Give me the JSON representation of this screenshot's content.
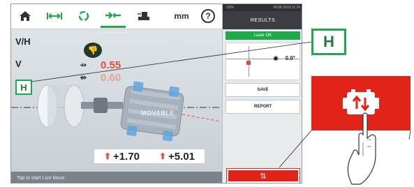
{
  "toolbar": {
    "items": [
      {
        "name": "home-icon",
        "glyph": "⌂"
      },
      {
        "name": "dimensions-icon",
        "glyph": "⟷"
      },
      {
        "name": "measure-icon",
        "glyph": "◌"
      },
      {
        "name": "results-icon",
        "glyph": "⇉"
      },
      {
        "name": "move-icon",
        "glyph": "▙"
      }
    ],
    "unit_label": "mm",
    "help_label": "?"
  },
  "side_labels": {
    "vh": "V/H",
    "v": "V",
    "h": "H"
  },
  "measurements": {
    "top_value": "0.55",
    "bottom_value": "0.60"
  },
  "machine_label": "MOVABLE",
  "bottom_values": {
    "left": "+1.70",
    "right": "+5.01"
  },
  "status_text": "Tap  to start Live Move.",
  "right_panel": {
    "status_left": "55%",
    "status_right": "09.08.2019 11:26",
    "title": "RESULTS",
    "laser_status": "Laser OK",
    "angle": "0.0°",
    "save_label": "SAVE",
    "report_label": "REPORT"
  },
  "callout_h_label": "H",
  "colors": {
    "accent_green": "#1faa4a",
    "alert_red": "#e2231a",
    "value_red": "#e84c40"
  }
}
